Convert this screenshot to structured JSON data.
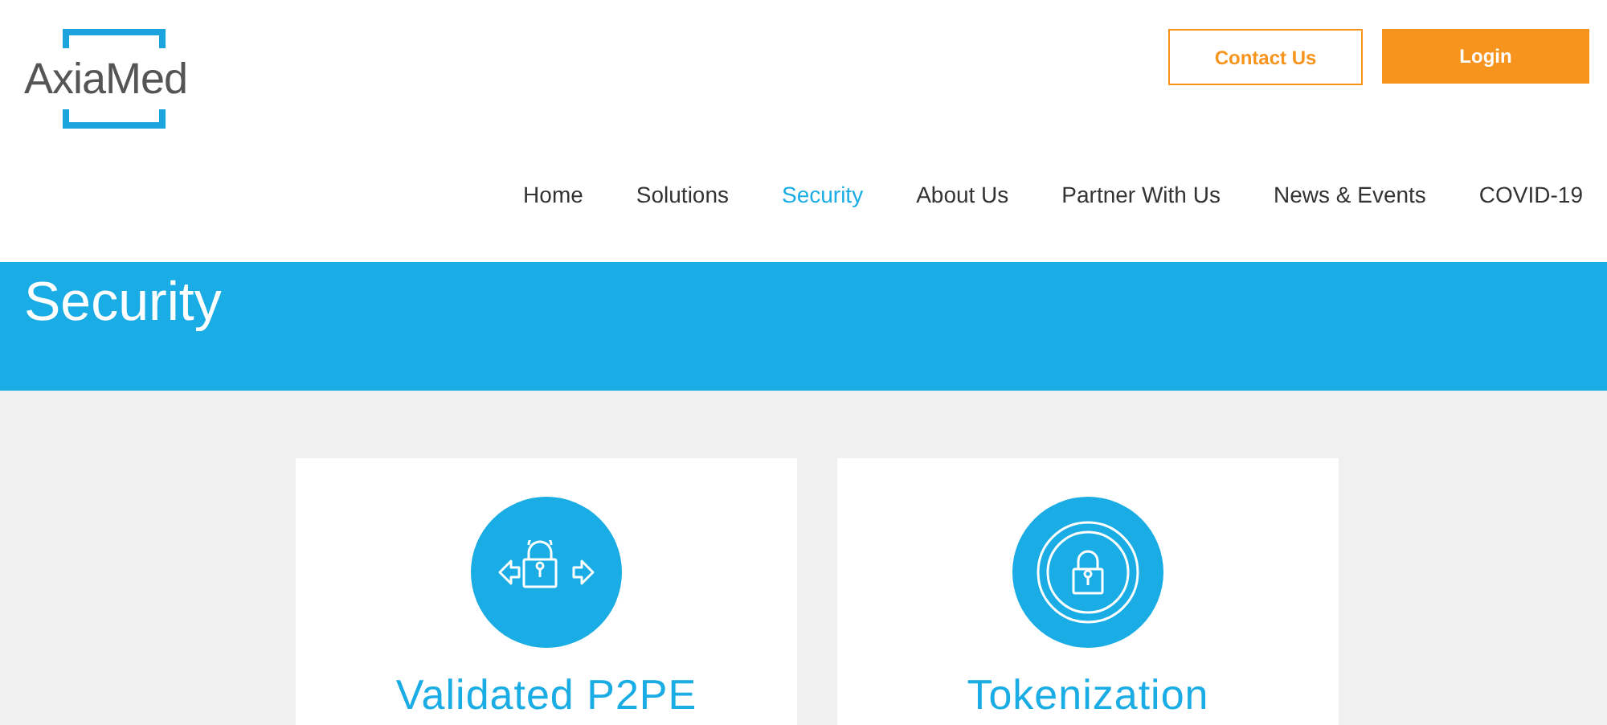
{
  "logo": {
    "text": "AxiaMed"
  },
  "header_buttons": [
    {
      "label": "Contact Us",
      "kind": "outline"
    },
    {
      "label": "Login",
      "kind": "solid"
    }
  ],
  "nav": [
    {
      "label": "Home",
      "selected": false
    },
    {
      "label": "Solutions",
      "selected": false
    },
    {
      "label": "Security",
      "selected": true
    },
    {
      "label": "About Us",
      "selected": false
    },
    {
      "label": "Partner With Us",
      "selected": false
    },
    {
      "label": "News & Events",
      "selected": false
    },
    {
      "label": "COVID-19",
      "selected": false
    }
  ],
  "banner": {
    "title": "Security"
  },
  "cards": [
    {
      "title": "Validated P2PE",
      "kind": "arrows-lock"
    },
    {
      "title": "Tokenization",
      "kind": "ring-lock"
    }
  ]
}
